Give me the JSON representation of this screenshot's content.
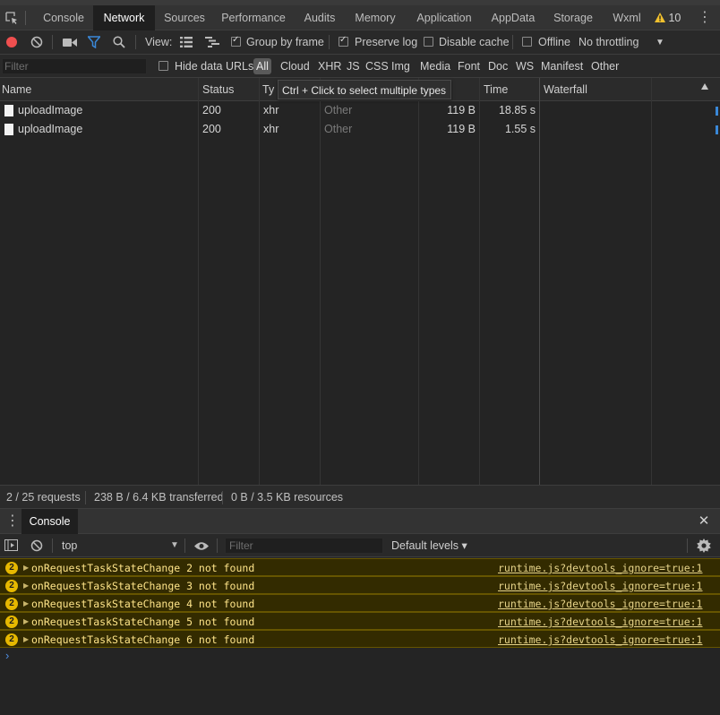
{
  "tabs": [
    {
      "label": "Console"
    },
    {
      "label": "Network"
    },
    {
      "label": "Sources"
    },
    {
      "label": "Performance"
    },
    {
      "label": "Audits"
    },
    {
      "label": "Memory"
    },
    {
      "label": "Application"
    },
    {
      "label": "AppData"
    },
    {
      "label": "Storage"
    },
    {
      "label": "Wxml"
    }
  ],
  "active_tab": "Network",
  "warning_count": "10",
  "toolbar": {
    "view_label": "View:",
    "group_by_frame": "Group by frame",
    "preserve_log": "Preserve log",
    "disable_cache": "Disable cache",
    "offline": "Offline",
    "throttling": "No throttling"
  },
  "filter": {
    "placeholder": "Filter",
    "hide_data_urls": "Hide data URLs",
    "types": [
      "All",
      "Cloud",
      "XHR",
      "JS",
      "CSS",
      "Img",
      "Media",
      "Font",
      "Doc",
      "WS",
      "Manifest",
      "Other"
    ]
  },
  "table": {
    "columns": {
      "name": "Name",
      "status": "Status",
      "type": "Ty",
      "time": "Time",
      "waterfall": "Waterfall"
    },
    "tooltip": "Ctrl + Click to select multiple types",
    "rows": [
      {
        "name": "uploadImage",
        "status": "200",
        "type": "xhr",
        "initiator": "Other",
        "size": "119 B",
        "time": "18.85 s"
      },
      {
        "name": "uploadImage",
        "status": "200",
        "type": "xhr",
        "initiator": "Other",
        "size": "119 B",
        "time": "1.55 s"
      }
    ]
  },
  "summary": {
    "requests": "2 / 25 requests",
    "transferred": "238 B / 6.4 KB transferred",
    "resources": "0 B / 3.5 KB resources"
  },
  "drawer": {
    "tab": "Console",
    "context": "top",
    "filter_placeholder": "Filter",
    "levels": "Default levels ▾"
  },
  "console_messages": [
    {
      "count": "2",
      "text": "onRequestTaskStateChange 2 not found",
      "source": "runtime.js?devtools_ignore=true:1"
    },
    {
      "count": "2",
      "text": "onRequestTaskStateChange 3 not found",
      "source": "runtime.js?devtools_ignore=true:1"
    },
    {
      "count": "2",
      "text": "onRequestTaskStateChange 4 not found",
      "source": "runtime.js?devtools_ignore=true:1"
    },
    {
      "count": "2",
      "text": "onRequestTaskStateChange 5 not found",
      "source": "runtime.js?devtools_ignore=true:1"
    },
    {
      "count": "2",
      "text": "onRequestTaskStateChange 6 not found",
      "source": "runtime.js?devtools_ignore=true:1"
    }
  ],
  "colors": {
    "record": "#ef4f4f",
    "warning_bg": "#332b00",
    "warning_text": "#ffe58a",
    "active_filter": "#3a88d8"
  }
}
